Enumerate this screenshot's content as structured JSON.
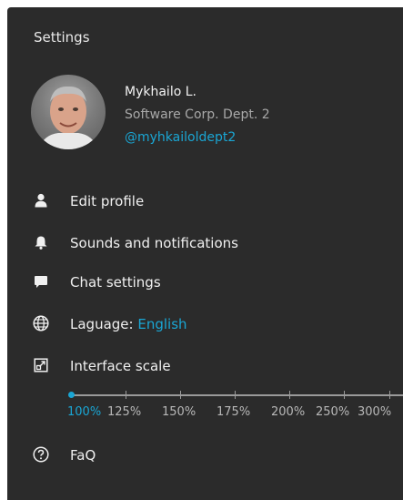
{
  "header": {
    "title": "Settings"
  },
  "profile": {
    "name": "Mykhailo L.",
    "organization": "Software Corp. Dept. 2",
    "handle": "@myhkailoldept2"
  },
  "menu": {
    "edit_profile": {
      "label": "Edit profile",
      "icon": "person-icon"
    },
    "sounds": {
      "label": "Sounds and notifications",
      "icon": "bell-icon"
    },
    "chat": {
      "label": "Chat settings",
      "icon": "chat-bubble-icon"
    },
    "language": {
      "label": "Laguage:",
      "value": "English",
      "icon": "globe-icon"
    },
    "scale": {
      "label": "Interface scale",
      "icon": "scale-icon"
    },
    "faq": {
      "label": "FaQ",
      "icon": "question-circle-icon"
    }
  },
  "scale_options": [
    "100%",
    "125%",
    "150%",
    "175%",
    "200%",
    "250%",
    "300%"
  ],
  "scale_selected": "100%",
  "colors": {
    "background": "#2b2b2b",
    "accent": "#1aa6d4",
    "text": "#f0f0f0",
    "muted": "#a8a8a8"
  }
}
